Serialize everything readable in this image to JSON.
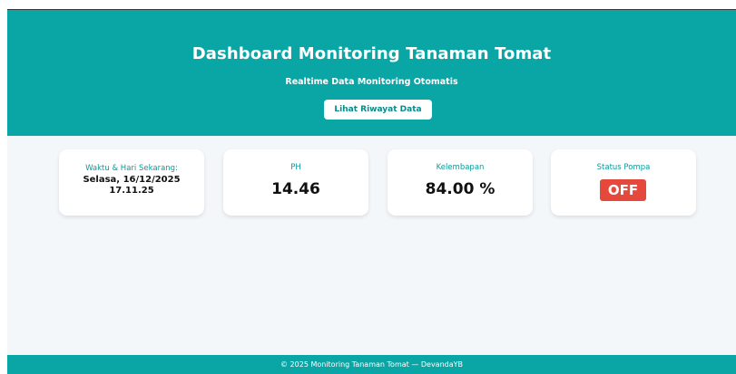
{
  "header": {
    "title": "Dashboard Monitoring Tanaman Tomat",
    "subtitle": "Realtime Data Monitoring Otomatis",
    "history_button_label": "Lihat Riwayat Data"
  },
  "cards": {
    "time": {
      "label": "Waktu & Hari Sekarang:",
      "date": "Selasa, 16/12/2025",
      "clock": "17.11.25"
    },
    "ph": {
      "label": "PH",
      "value": "14.46"
    },
    "humidity": {
      "label": "Kelembapan",
      "value": "84.00 %"
    },
    "pump": {
      "label": "Status Pompa",
      "status": "OFF"
    }
  },
  "footer": {
    "text": "© 2025 Monitoring Tanaman Tomat — DevandaYB"
  },
  "colors": {
    "accent": "#0aa6a6",
    "off_status": "#e4493c",
    "background": "#f4f7fa"
  }
}
